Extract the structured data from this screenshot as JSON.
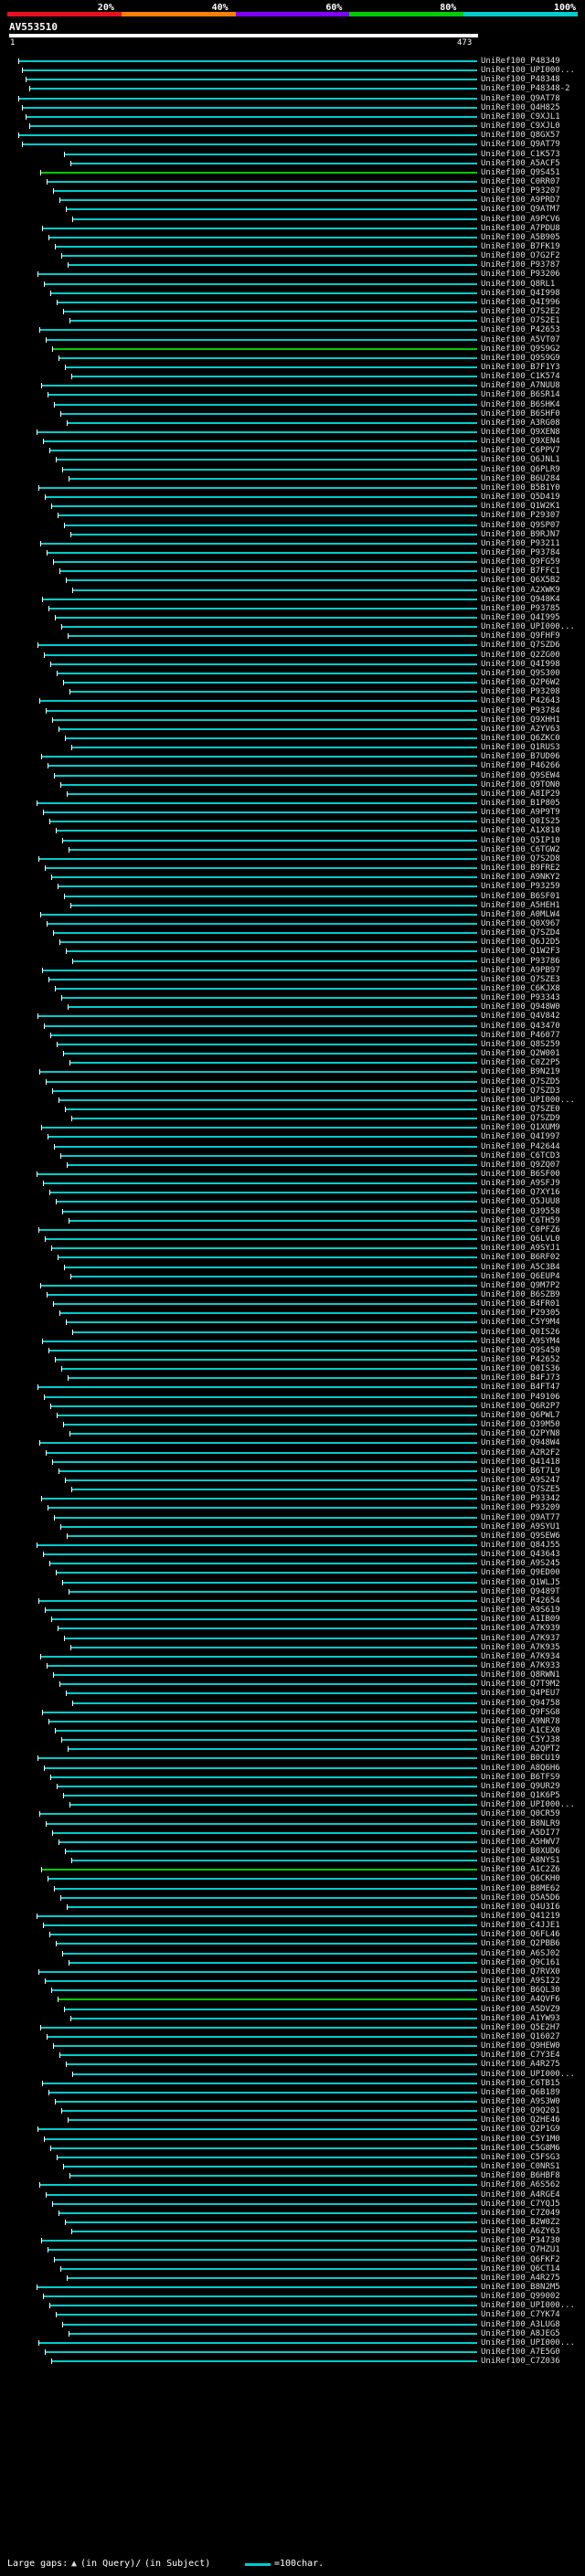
{
  "scale": {
    "labels": [
      "20%",
      "40%",
      "60%",
      "80%",
      "100%"
    ],
    "colors": [
      "#e8101e",
      "#ff7f00",
      "#7f00ff",
      "#00cc00",
      "#00cccc"
    ]
  },
  "query": {
    "id": "AV553510",
    "start": "1",
    "end": "473"
  },
  "hits": [
    "UniRef100_P48349",
    "UniRef100_UPI000...",
    "UniRef100_P48348",
    "UniRef100_P48348-2",
    "UniRef100_Q9AT78",
    "UniRef100_Q4H825",
    "UniRef100_C9XJL1",
    "UniRef100_C9XJL0",
    "UniRef100_Q8GX57",
    "UniRef100_Q9AT79",
    "UniRef100_C1K573",
    "UniRef100_A5ACF5",
    "UniRef100_Q9S451",
    "UniRef100_C0RR07",
    "UniRef100_P93207",
    "UniRef100_A9PRD7",
    "UniRef100_Q9ATM7",
    "UniRef100_A9PCV6",
    "UniRef100_A7PDU8",
    "UniRef100_A5B905",
    "UniRef100_B7FK19",
    "UniRef100_O7G2F2",
    "UniRef100_P93787",
    "UniRef100_P93206",
    "UniRef100_Q8RL1",
    "UniRef100_Q4I998",
    "UniRef100_Q4I996",
    "UniRef100_O7S2E2",
    "UniRef100_O7S2E1",
    "UniRef100_P42653",
    "UniRef100_A5VT07",
    "UniRef100_Q9S9G2",
    "UniRef100_Q9S9G9",
    "UniRef100_B7F1Y3",
    "UniRef100_C1K574",
    "UniRef100_A7NUU8",
    "UniRef100_B6SR14",
    "UniRef100_B6SHK4",
    "UniRef100_B6SHF0",
    "UniRef100_A3RG08",
    "UniRef100_Q9XEN8",
    "UniRef100_Q9XEN4",
    "UniRef100_C6PPV7",
    "UniRef100_Q6JNL1",
    "UniRef100_Q6PLR9",
    "UniRef100_B6U284",
    "UniRef100_B5B1Y0",
    "UniRef100_Q5D419",
    "UniRef100_Q1W2K1",
    "UniRef100_P29307",
    "UniRef100_Q9SP07",
    "UniRef100_B9RJN7",
    "UniRef100_P93211",
    "UniRef100_P93784",
    "UniRef100_Q9FG59",
    "UniRef100_B7FFC1",
    "UniRef100_Q6X5B2",
    "UniRef100_A2XWK9",
    "UniRef100_Q948K4",
    "UniRef100_P93785",
    "UniRef100_Q4I995",
    "UniRef100_UPI000...",
    "UniRef100_Q9FHF9",
    "UniRef100_Q7SZD6",
    "UniRef100_Q2ZG00",
    "UniRef100_Q4I998",
    "UniRef100_Q9S300",
    "UniRef100_Q2P6W2",
    "UniRef100_P93208",
    "UniRef100_P42643",
    "UniRef100_P93784",
    "UniRef100_Q9XHH1",
    "UniRef100_A2YV63",
    "UniRef100_Q6ZKC0",
    "UniRef100_Q1RUS3",
    "UniRef100_B7UD06",
    "UniRef100_P46266",
    "UniRef100_Q9SEW4",
    "UniRef100_Q9TON0",
    "UniRef100_A8IP29",
    "UniRef100_B1P805",
    "UniRef100_A9P9T9",
    "UniRef100_Q0IS25",
    "UniRef100_A1X810",
    "UniRef100_Q5IP10",
    "UniRef100_C6TGW2",
    "UniRef100_Q7S2D8",
    "UniRef100_B9FRE2",
    "UniRef100_A9NKY2",
    "UniRef100_P93259",
    "UniRef100_B6SF01",
    "UniRef100_A5HEH1",
    "UniRef100_A0MLW4",
    "UniRef100_Q0X967",
    "UniRef100_Q7SZD4",
    "UniRef100_Q6J2D5",
    "UniRef100_Q1W2F3",
    "UniRef100_P93786",
    "UniRef100_A9PB97",
    "UniRef100_Q7SZE3",
    "UniRef100_C6KJX8",
    "UniRef100_P93343",
    "UniRef100_Q948W0",
    "UniRef100_Q4V842",
    "UniRef100_Q43470",
    "UniRef100_P46077",
    "UniRef100_Q8S259",
    "UniRef100_Q2W001",
    "UniRef100_C0Z2P5",
    "UniRef100_B9N219",
    "UniRef100_Q7SZD5",
    "UniRef100_Q7SZD3",
    "UniRef100_UPI000...",
    "UniRef100_Q7SZE0",
    "UniRef100_Q7SZD9",
    "UniRef100_Q1XUM9",
    "UniRef100_Q4I997",
    "UniRef100_P42644",
    "UniRef100_C6TCD3",
    "UniRef100_Q9ZQ07",
    "UniRef100_B6SF00",
    "UniRef100_A9SFJ9",
    "UniRef100_Q7XY16",
    "UniRef100_Q5JUU8",
    "UniRef100_Q39558",
    "UniRef100_C6TH59",
    "UniRef100_C0PFZ6",
    "UniRef100_Q6LVL0",
    "UniRef100_A9SYJ1",
    "UniRef100_B6RF02",
    "UniRef100_A5C3B4",
    "UniRef100_Q6EUP4",
    "UniRef100_Q9M7P2",
    "UniRef100_B6SZB9",
    "UniRef100_B4FR01",
    "UniRef100_P29305",
    "UniRef100_C5Y9M4",
    "UniRef100_Q0IS26",
    "UniRef100_A9SYM4",
    "UniRef100_Q9S450",
    "UniRef100_P42652",
    "UniRef100_Q0IS36",
    "UniRef100_B4FJ73",
    "UniRef100_B4FT47",
    "UniRef100_P49106",
    "UniRef100_Q6R2P7",
    "UniRef100_Q6PWL7",
    "UniRef100_Q39M50",
    "UniRef100_Q2PYN8",
    "UniRef100_Q948W4",
    "UniRef100_A2R2F2",
    "UniRef100_Q41418",
    "UniRef100_B6T7L9",
    "UniRef100_A9S247",
    "UniRef100_Q7SZE5",
    "UniRef100_P93342",
    "UniRef100_P93209",
    "UniRef100_Q9AT77",
    "UniRef100_A9SYU1",
    "UniRef100_Q9SEW6",
    "UniRef100_Q84J55",
    "UniRef100_Q43643",
    "UniRef100_A9S245",
    "UniRef100_Q9ED00",
    "UniRef100_Q1WLJ5",
    "UniRef100_Q9489T",
    "UniRef100_P42654",
    "UniRef100_A9S619",
    "UniRef100_A1IB09",
    "UniRef100_A7K939",
    "UniRef100_A7K937",
    "UniRef100_A7K935",
    "UniRef100_A7K934",
    "UniRef100_A7K933",
    "UniRef100_Q8RWN1",
    "UniRef100_Q7T9M2",
    "UniRef100_Q4PEU7",
    "UniRef100_Q94758",
    "UniRef100_Q9FSG8",
    "UniRef100_A9NR78",
    "UniRef100_A1CEX0",
    "UniRef100_C5YJ38",
    "UniRef100_A2QPT2",
    "UniRef100_B0CU19",
    "UniRef100_A8Q6H6",
    "UniRef100_B6TFS9",
    "UniRef100_Q9UR29",
    "UniRef100_Q1K6P5",
    "UniRef100_UPI000...",
    "UniRef100_Q0CR59",
    "UniRef100_B8NLR9",
    "UniRef100_A5DI77",
    "UniRef100_A5HWV7",
    "UniRef100_B0XUD6",
    "UniRef100_A8NYS1",
    "UniRef100_A1C2Z6",
    "UniRef100_Q6CKH0",
    "UniRef100_B8ME62",
    "UniRef100_Q5A5D6",
    "UniRef100_Q4U3I6",
    "UniRef100_Q41219",
    "UniRef100_C4JJE1",
    "UniRef100_Q6FL46",
    "UniRef100_Q2PBB6",
    "UniRef100_A6SJ02",
    "UniRef100_Q9C161",
    "UniRef100_Q7RVX0",
    "UniRef100_A9SI22",
    "UniRef100_B6QL30",
    "UniRef100_A4QVF6",
    "UniRef100_A5DVZ9",
    "UniRef100_A1YW93",
    "UniRef100_Q5E2H7",
    "UniRef100_Q16027",
    "UniRef100_Q9HEW0",
    "UniRef100_C7Y3E4",
    "UniRef100_A4R275",
    "UniRef100_UPI000...",
    "UniRef100_C6TB15",
    "UniRef100_Q6B189",
    "UniRef100_A9S3W0",
    "UniRef100_Q9Q201",
    "UniRef100_Q2HE46",
    "UniRef100_Q2P1G9",
    "UniRef100_C5Y1M0",
    "UniRef100_C5G8M6",
    "UniRef100_C5FSG3",
    "UniRef100_C0NRS1",
    "UniRef100_B6HBF8",
    "UniRef100_A6S562",
    "UniRef100_A4RGE4",
    "UniRef100_C7YQJ5",
    "UniRef100_C7Z049",
    "UniRef100_B2W0Z2",
    "UniRef100_A6ZY63",
    "UniRef100_P34730",
    "UniRef100_Q7HZU1",
    "UniRef100_Q6FKF2",
    "UniRef100_Q6CT14",
    "UniRef100_A4R275",
    "UniRef100_B8N2M5",
    "UniRef100_Q99002",
    "UniRef100_UPI000...",
    "UniRef100_C7YK74",
    "UniRef100_A3LUG8",
    "UniRef100_A8JEG5",
    "UniRef100_UPI000...",
    "UniRef100_A7E5G0",
    "UniRef100_C7Z036"
  ],
  "legend": {
    "gaps_label": "Large gaps: ",
    "in_query": "(in Query)/",
    "in_subject": " (in Subject)",
    "scale_label": "=100char."
  }
}
